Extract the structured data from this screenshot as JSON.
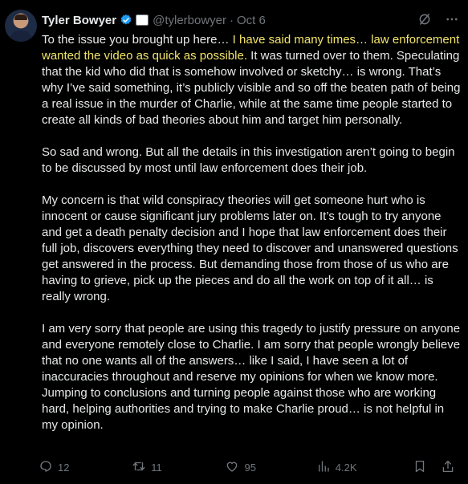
{
  "author": {
    "name": "Tyler Bowyer",
    "handle": "@tylerbowyer",
    "separator": "·",
    "date": "Oct 6"
  },
  "icons": {
    "avatar": "profile-photo",
    "verified": "verified-badge-icon",
    "flag": "flag-icon",
    "grok": "grok-icon",
    "more": "more-icon",
    "reply": "reply-icon",
    "retweet": "retweet-icon",
    "like": "heart-icon",
    "views": "analytics-icon",
    "bookmark": "bookmark-icon",
    "share": "share-icon"
  },
  "colors": {
    "highlight": "#f2e46a",
    "verified": "#1d9bf0",
    "muted": "#71767b"
  },
  "body": {
    "p1_a": "To the issue you brought up here… ",
    "p1_highlight": "I have said many times… law enforcement wanted the video as quick as possible.",
    "p1_b": " It was turned over to them. Speculating that the kid who did that is somehow involved or sketchy… is wrong. That’s why I’ve said something, it’s publicly visible and so off the beaten path of being a real issue in the murder of Charlie, while at the same time people started to create all kinds of bad theories about him and target him personally.",
    "p2": "So sad and wrong. But all the details in this investigation aren’t going to begin to be discussed by most until law enforcement does their job.",
    "p3": "My concern is that wild conspiracy theories will get someone hurt who is innocent or cause significant jury problems later on. It’s tough to try anyone and get a death penalty decision and I hope that law enforcement does their full job, discovers everything they need to discover and unanswered questions get answered in the process. But demanding those from those of us who are having to grieve, pick up the pieces and do all the work on top of it all… is really wrong.",
    "p4": "I am very sorry that people are using this tragedy to justify pressure on anyone and everyone remotely close to Charlie. I am sorry that people wrongly believe that no one wants all of the answers… like I said, I have seen a lot of inaccuracies throughout and reserve my opinions for when we know more. Jumping to conclusions and turning people against those who are working hard, helping authorities and trying to make Charlie proud… is not helpful in my opinion."
  },
  "stats": {
    "replies": "12",
    "retweets": "11",
    "likes": "95",
    "views": "4.2K"
  }
}
